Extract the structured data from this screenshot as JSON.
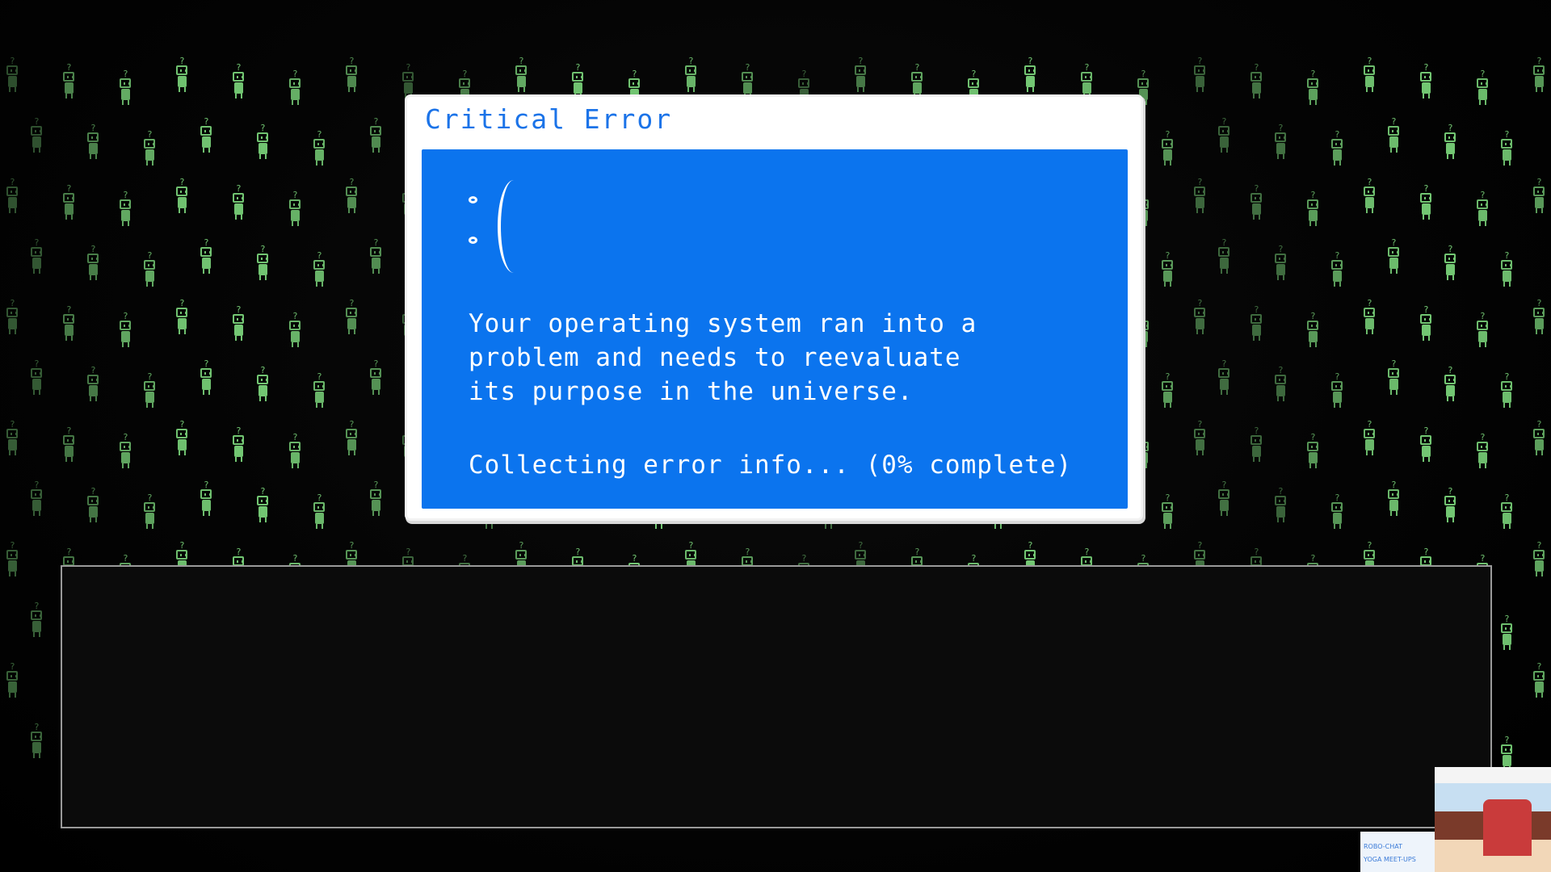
{
  "error_window": {
    "title": "Critical Error",
    "message": "Your operating system ran into a\nproblem and needs to reevaluate\nits purpose in the universe.",
    "progress_text": "Collecting error info... (0% complete)",
    "progress_percent": 0
  },
  "background": {
    "glyph": "?",
    "figure_color": "#7fdc7f"
  },
  "corner_thumbnail": {
    "links": [
      "ROBO-CHAT",
      "YOGA MEET-UPS"
    ]
  },
  "colors": {
    "panel_blue": "#0b74ee",
    "title_blue": "#1b73e8",
    "dialogue_bg": "#0b0b0b"
  }
}
